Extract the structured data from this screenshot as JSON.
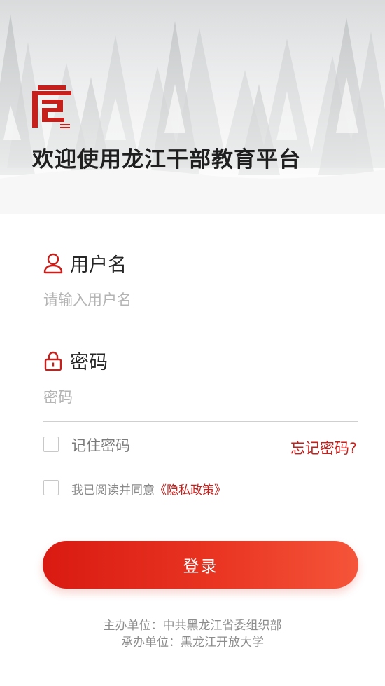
{
  "header": {
    "title": "欢迎使用龙江干部教育平台"
  },
  "form": {
    "username": {
      "label": "用户名",
      "placeholder": "请输入用户名",
      "icon": "user-icon"
    },
    "password": {
      "label": "密码",
      "placeholder": "密码",
      "icon": "lock-icon"
    },
    "remember_label": "记住密码",
    "forgot_label": "忘记密码?",
    "agree_prefix": "我已阅读并同意",
    "privacy_link": "《隐私政策》",
    "login_label": "登录"
  },
  "footer": {
    "host": "主办单位：中共黑龙江省委组织部",
    "organizer": "承办单位：黑龙江开放大学"
  },
  "colors": {
    "accent": "#c6201c",
    "button_start": "#d91a12",
    "button_end": "#f5553a"
  }
}
